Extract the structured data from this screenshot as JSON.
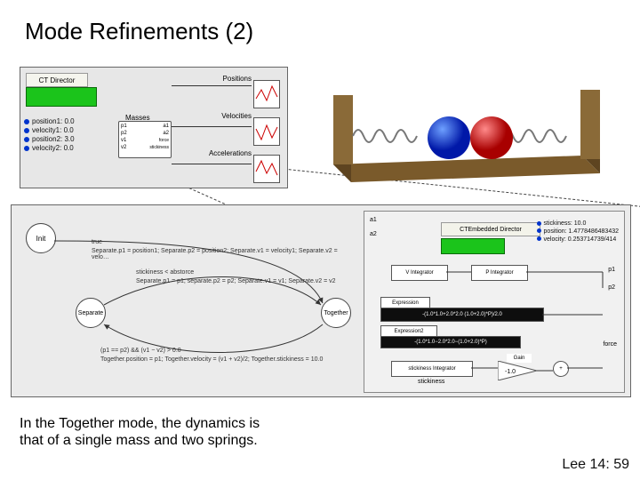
{
  "title": "Mode Refinements (2)",
  "footer": "Lee 14: 59",
  "caption_line1": "In the Together mode, the dynamics is",
  "caption_line2": "that of a single mass and two springs.",
  "panelA": {
    "director": "CT Director",
    "masses": "Masses",
    "params": [
      "position1: 0.0",
      "velocity1: 0.0",
      "position2: 3.0",
      "velocity2: 0.0"
    ],
    "ports": [
      "p1",
      "p2",
      "v1",
      "v2",
      "a1",
      "a2",
      "force",
      "stickiness"
    ],
    "plots": [
      "Positions",
      "Velocities",
      "Accelerations"
    ]
  },
  "fsm": {
    "states": [
      "Init",
      "Separate",
      "Together"
    ],
    "g_init": "true",
    "a_init": "Separate.p1 = position1; Separate.p2 = position2; Separate.v1 = velocity1; Separate.v2 = velo…",
    "g_sep_to_tog": "stickiness < abstorce",
    "a_sep_to_tog": "Separate.p1 = p1; separate.p2 = p2; Separate.v1 = v1; Separate.v2 = v2",
    "g_tog_to_sep": "(p1 == p2) && (v1 − v2) > 0.0",
    "a_tog_to_sep": "Together.position = p1; Together.velocity = (v1 + v2)/2; Together.stickiness = 10.0"
  },
  "refine": {
    "director": "CTEmbedded Director",
    "params": [
      "stickiness: 10.0",
      "position: 1.4778486483432",
      "velocity: 0.253714739/414"
    ],
    "io": [
      "a1",
      "a2",
      "p1",
      "p2",
      "force"
    ],
    "blocks": {
      "vint": "V Integrator",
      "pint": "P Integrator",
      "expr": "Expression",
      "exprBody": "-(1.0*1.0+2.0*2.0   (1.0+2.0)*P)/2.0",
      "expr2": "Expression2",
      "sint": "stickiness Integrator",
      "gain": "Gain",
      "gainVal": "-1.0",
      "add": "+",
      "force": "force",
      "stick": "stickiness"
    }
  }
}
